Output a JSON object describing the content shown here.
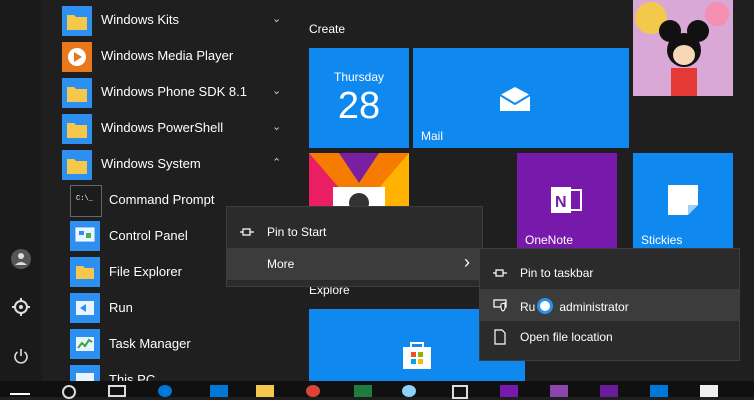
{
  "start_menu": {
    "apps": [
      {
        "label": "Windows Kits",
        "chevron": "⌄"
      },
      {
        "label": "Windows Media Player"
      },
      {
        "label": "Windows Phone SDK 8.1",
        "chevron": "⌄"
      },
      {
        "label": "Windows PowerShell",
        "chevron": "⌄"
      },
      {
        "label": "Windows System",
        "chevron": "⌃"
      }
    ],
    "system_apps": [
      {
        "label": "Command Prompt"
      },
      {
        "label": "Control Panel"
      },
      {
        "label": "File Explorer"
      },
      {
        "label": "Run"
      },
      {
        "label": "Task Manager"
      },
      {
        "label": "This PC"
      }
    ]
  },
  "tiles": {
    "create_label": "Create",
    "explore_label": "Explore",
    "calendar": {
      "day": "Thursday",
      "date": "28"
    },
    "mail_label": "Mail",
    "onenote_label": "OneNote",
    "stickies_label": "Stickies"
  },
  "context_menu": {
    "pin_to_start": "Pin to Start",
    "more": "More",
    "more_arrow": "›"
  },
  "submenu": {
    "pin_to_taskbar": "Pin to taskbar",
    "run_as_admin_prefix": "Ru",
    "run_as_admin_suffix": "administrator",
    "open_file_location": "Open file location"
  },
  "colors": {
    "accent": "#0f88f0",
    "onenote": "#7719aa",
    "menu_bg": "#2b2b2b"
  }
}
